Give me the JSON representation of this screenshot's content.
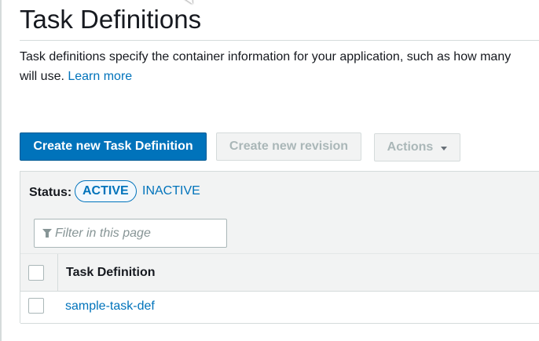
{
  "page": {
    "title": "Task Definitions",
    "description_text": "Task definitions specify the container information for your application, such as how many",
    "description_line2": "will use.",
    "learn_more": "Learn more"
  },
  "toolbar": {
    "create_task_def_label": "Create new Task Definition",
    "create_revision_label": "Create new revision",
    "actions_label": "Actions"
  },
  "status_filter": {
    "label": "Status:",
    "active_label": "ACTIVE",
    "inactive_label": "INACTIVE",
    "selected": "ACTIVE"
  },
  "search": {
    "placeholder": "Filter in this page",
    "value": ""
  },
  "table": {
    "columns": [
      "Task Definition"
    ],
    "rows": [
      {
        "task_definition": "sample-task-def",
        "checked": false
      }
    ]
  },
  "colors": {
    "accent": "#0073bb",
    "primary_button": "#0073bb",
    "panel_background": "#f2f3f3",
    "disabled_text": "#aab7b8"
  },
  "icons": [
    "filter-icon",
    "caret-down-icon"
  ]
}
